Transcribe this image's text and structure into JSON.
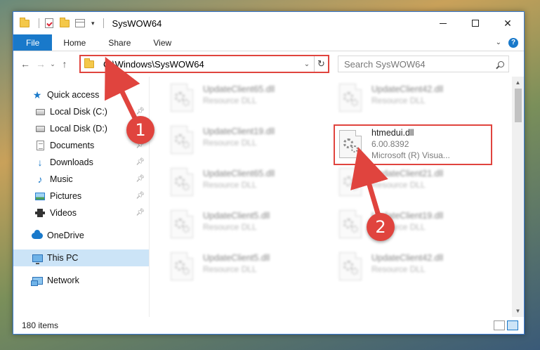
{
  "window": {
    "title": "SysWOW64"
  },
  "ribbon": {
    "tabs": [
      "File",
      "Home",
      "Share",
      "View"
    ]
  },
  "address": {
    "path": "C:\\Windows\\SysWOW64"
  },
  "search": {
    "placeholder": "Search SysWOW64"
  },
  "sidebar": {
    "items": [
      {
        "label": "Quick access",
        "icon": "star-icon",
        "pinned": false
      },
      {
        "label": "Local Disk (C:)",
        "icon": "drive-icon",
        "pinned": true
      },
      {
        "label": "Local Disk (D:)",
        "icon": "drive-icon",
        "pinned": false
      },
      {
        "label": "Documents",
        "icon": "documents-icon",
        "pinned": true
      },
      {
        "label": "Downloads",
        "icon": "downloads-icon",
        "pinned": true
      },
      {
        "label": "Music",
        "icon": "music-icon",
        "pinned": true
      },
      {
        "label": "Pictures",
        "icon": "pictures-icon",
        "pinned": true
      },
      {
        "label": "Videos",
        "icon": "videos-icon",
        "pinned": true
      },
      {
        "label": "OneDrive",
        "icon": "onedrive-icon"
      },
      {
        "label": "This PC",
        "icon": "this-pc-icon",
        "selected": true
      },
      {
        "label": "Network",
        "icon": "network-icon"
      }
    ]
  },
  "files": {
    "col1": [
      {
        "name": "UpdateClient65.dll",
        "desc": "Resource DLL"
      },
      {
        "name": "UpdateClient19.dll",
        "desc": "Resource DLL"
      },
      {
        "name": "UpdateClient65.dll",
        "desc": "Resource DLL"
      },
      {
        "name": "UpdateClient5.dll",
        "desc": "Resource DLL"
      },
      {
        "name": "UpdateClient5.dll",
        "desc": "Resource DLL"
      }
    ],
    "col2": [
      {
        "name": "UpdateClient42.dll",
        "desc": "Resource DLL"
      },
      {
        "name": "UpdateClient21.dll",
        "desc": "Resource DLL"
      },
      {
        "name": "UpdateClient19.dll",
        "desc": "Resource DLL"
      },
      {
        "name": "UpdateClient42.dll",
        "desc": "Resource DLL"
      }
    ],
    "highlighted": {
      "name": "htmedui.dll",
      "version": "6.00.8392",
      "company": "Microsoft (R) Visua..."
    }
  },
  "status": {
    "item_count": "180 items"
  },
  "annotations": {
    "step1": "1",
    "step2": "2",
    "accent": "#e0443e"
  }
}
